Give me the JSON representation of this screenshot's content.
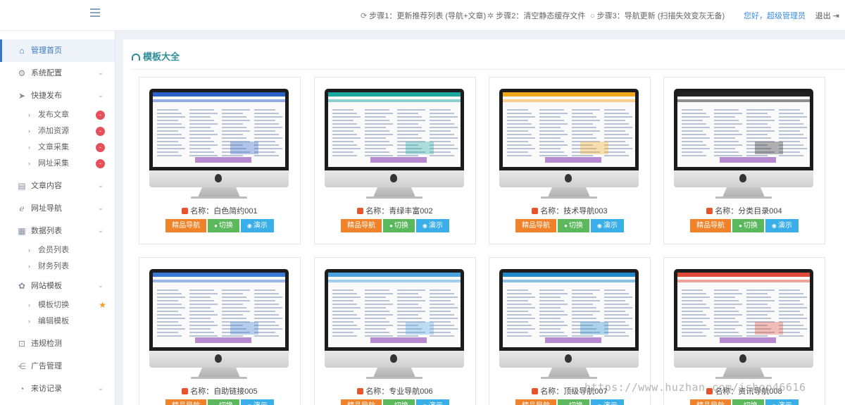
{
  "topbar": {
    "steps": [
      {
        "icon": "refresh-icon",
        "label": "步骤1：更新推荐列表 (导航+文章)"
      },
      {
        "icon": "spinner-icon",
        "label": "步骤2：清空静态缓存文件"
      },
      {
        "icon": "circle-icon",
        "label": "步骤3：导航更新 (扫描失效变灰无备)"
      }
    ],
    "greeting": "您好，超级管理员",
    "logout": "退出"
  },
  "sidebar": {
    "home": "管理首页",
    "settings": "系统配置",
    "publish": "快捷发布",
    "publish_sub": [
      "发布文章",
      "添加资源",
      "文章采集",
      "网址采集"
    ],
    "content": "文章内容",
    "nav": "网址导航",
    "data": "数据列表",
    "data_sub": [
      "会员列表",
      "财务列表"
    ],
    "template": "网站模板",
    "template_sub": [
      "模板切换",
      "编辑模板"
    ],
    "violation": "违规检测",
    "ads": "广告管理",
    "visits": "来访记录"
  },
  "main": {
    "title": "模板大全",
    "cards": [
      {
        "name": "名称：白色简约001",
        "accent": "#2a62c9"
      },
      {
        "name": "名称：青绿丰富002",
        "accent": "#1aa7a0"
      },
      {
        "name": "名称：技术导航003",
        "accent": "#f3a81c"
      },
      {
        "name": "名称：分类目录004",
        "accent": "#222222"
      },
      {
        "name": "名称：自助链接005",
        "accent": "#3a78d6"
      },
      {
        "name": "名称：专业导航006",
        "accent": "#4aa3df"
      },
      {
        "name": "名称：顶级导航007",
        "accent": "#1e88c8"
      },
      {
        "name": "名称：资讯导航008",
        "accent": "#e04a3a"
      }
    ],
    "buttons": {
      "premium": "精品导航",
      "switch": "切换",
      "demo": "演示"
    }
  },
  "watermark": "https://www.huzhan.com/ishop46616"
}
